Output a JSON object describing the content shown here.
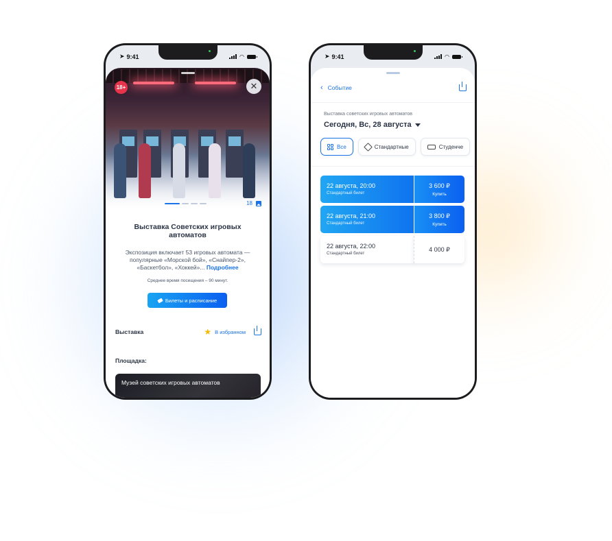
{
  "colors": {
    "accent": "#1a73e8",
    "badge": "#e8344b",
    "star": "#f5b800"
  },
  "status_bar": {
    "time": "9:41"
  },
  "event_screen": {
    "age_rating": "18+",
    "close_icon": "close-icon",
    "photo_count": "18",
    "title": "Выставка Советских игровых автоматов",
    "description": "Экспозиция включает 53 игровых автомата — популярные «Морской бой», «Снайпер-2», «Баскетбол», «Хоккей»...",
    "more_link": "Подробнее",
    "duration": "Среднее время посещения – 90 минут.",
    "tickets_button": "Билеты и расписание",
    "type_label": "Выставка",
    "favorite_label": "В избранном",
    "venue_label": "Площадка:",
    "venue_name": "Музей советских игровых автоматов"
  },
  "schedule_screen": {
    "back_label": "Событие",
    "event_name": "Выставка советских игровых автоматов",
    "date": "Сегодня, Вс, 28 августа",
    "filters": [
      "Все",
      "Стандартные",
      "Студенче"
    ],
    "slots": [
      {
        "when": "22 августа, 20:00",
        "kind": "Стандартный билет",
        "price": "3 600 ₽",
        "action": "Купить",
        "selected": true
      },
      {
        "when": "22 августа, 21:00",
        "kind": "Стандартный билет",
        "price": "3 800 ₽",
        "action": "Купить",
        "selected": true
      },
      {
        "when": "22 августа, 22:00",
        "kind": "Стандартный билет",
        "price": "4 000 ₽",
        "action": "",
        "selected": false
      }
    ]
  }
}
